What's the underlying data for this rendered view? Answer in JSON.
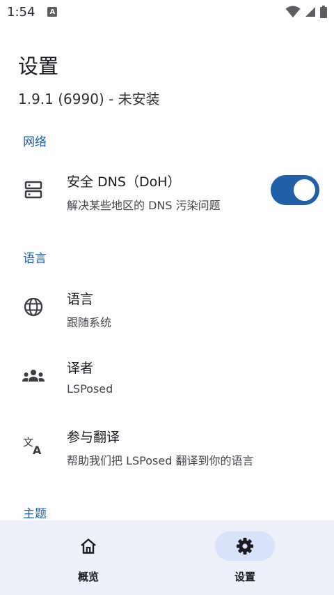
{
  "status": {
    "time": "1:54",
    "indicator": "A"
  },
  "header": {
    "title": "设置",
    "version": "1.9.1 (6990) - 未安装"
  },
  "sections": {
    "network": "网络",
    "language": "语言",
    "theme": "主题"
  },
  "items": {
    "dns": {
      "title": "安全 DNS（DoH）",
      "subtitle": "解决某些地区的 DNS 污染问题",
      "enabled": true
    },
    "language": {
      "title": "语言",
      "subtitle": "跟随系统"
    },
    "translators": {
      "title": "译者",
      "subtitle": "LSPosed"
    },
    "translate": {
      "title": "参与翻译",
      "subtitle": "帮助我们把 LSPosed 翻译到你的语言"
    }
  },
  "nav": {
    "overview": "概览",
    "settings": "设置",
    "active": "settings"
  },
  "colors": {
    "accent": "#1f60a8",
    "section_text": "#1d5fa8",
    "nav_background": "#edf0f8",
    "nav_active_pill": "#d8e2f8"
  }
}
